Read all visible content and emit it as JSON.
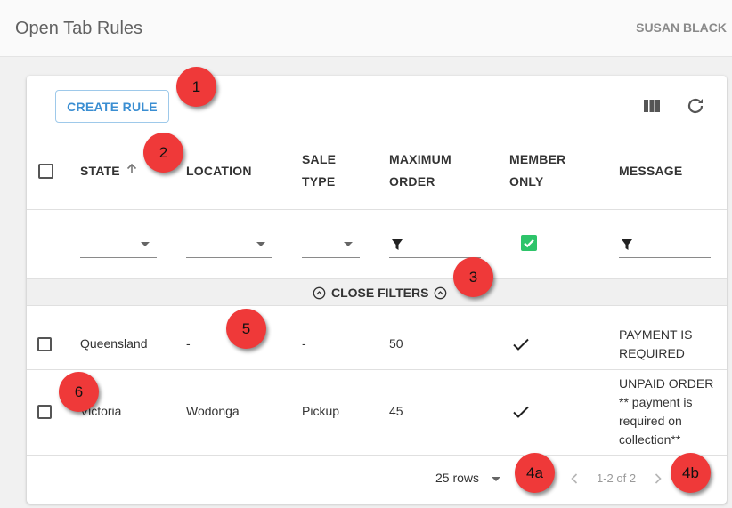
{
  "header": {
    "app_title": "Open Tab Rules",
    "user_name": "SUSAN BLACK"
  },
  "toolbar": {
    "create_label": "CREATE RULE",
    "columns_icon": "view-column-icon",
    "refresh_icon": "refresh-icon"
  },
  "table": {
    "columns": [
      {
        "label": "STATE",
        "sorted": "ascending"
      },
      {
        "label": "LOCATION"
      },
      {
        "label": "SALE TYPE"
      },
      {
        "label": "MAXIMUM ORDER"
      },
      {
        "label": "MEMBER ONLY"
      },
      {
        "label": "MESSAGE"
      }
    ],
    "filters": {
      "member_only_checked": true,
      "close_filters_label": "CLOSE FILTERS"
    },
    "rows": [
      {
        "state": "Queensland",
        "location": "-",
        "sale_type": "-",
        "maximum_order": "50",
        "member_only": true,
        "message": "PAYMENT IS REQUIRED"
      },
      {
        "state": "Victoria",
        "location": "Wodonga",
        "sale_type": "Pickup",
        "maximum_order": "45",
        "member_only": true,
        "message": "UNPAID ORDER ** payment is required on collection**"
      }
    ]
  },
  "pagination": {
    "rows_per_page_label": "25 rows",
    "range_label": "1-2 of 2"
  },
  "callouts": [
    "1",
    "2",
    "3",
    "4a",
    "4b",
    "5",
    "6"
  ],
  "colors": {
    "accent": "#3a8ed2",
    "callout": "#ef3939",
    "checkbox_checked": "#2ec46a"
  }
}
